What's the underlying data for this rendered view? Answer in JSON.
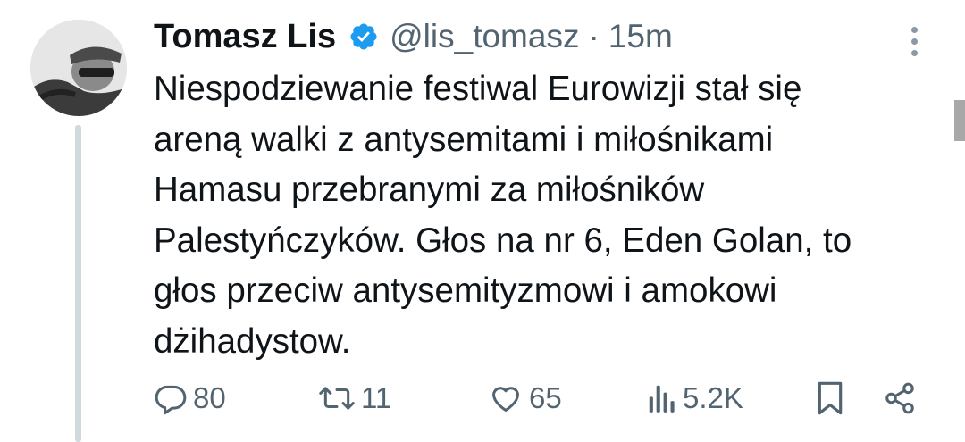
{
  "tweet": {
    "author": {
      "display_name": "Tomasz Lis",
      "handle": "@lis_tomasz",
      "verified": true
    },
    "separator": "·",
    "time": "15m",
    "text_lines": [
      "Niespodziewanie festiwal Eurowizji stał się",
      "areną walki z antysemitami i miłośnikami",
      "Hamasu przebranymi za miłośników",
      "Palestyńczyków. Głos na nr 6, Eden Golan, to",
      "głos przeciw antysemityzmowi i amokowi",
      "dżihadystow."
    ],
    "actions": {
      "reply_count": "80",
      "retweet_count": "11",
      "like_count": "65",
      "view_count": "5.2K"
    }
  },
  "icons": {
    "verified": "verified-badge-icon",
    "more": "more-vertical-icon",
    "reply": "reply-icon",
    "retweet": "retweet-icon",
    "like": "heart-icon",
    "views": "views-icon",
    "bookmark": "bookmark-icon",
    "share": "share-icon"
  },
  "colors": {
    "verified_blue": "#1d9bf0",
    "secondary_text": "#536471",
    "primary_text": "#0f1419"
  }
}
